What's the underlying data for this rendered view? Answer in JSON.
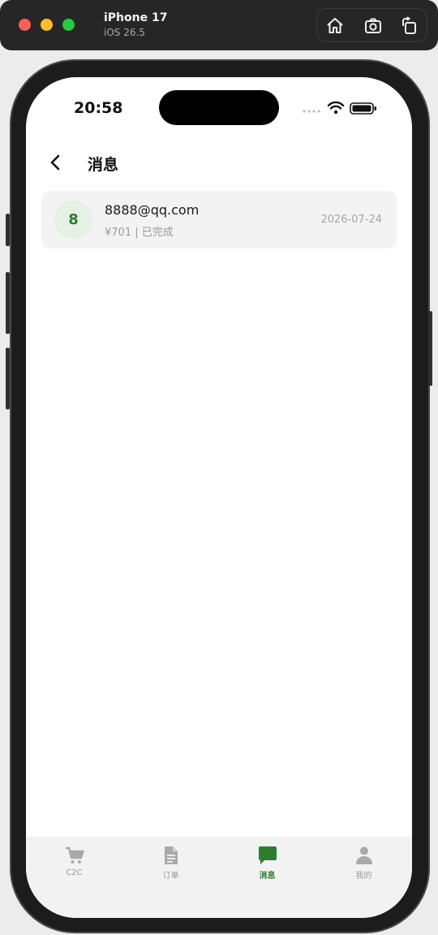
{
  "simulator": {
    "device_name": "iPhone 17",
    "os_version": "iOS 26.5",
    "tools": [
      "home-icon",
      "screenshot-icon",
      "rotate-icon"
    ]
  },
  "status_bar": {
    "time": "20:58"
  },
  "nav": {
    "title": "消息"
  },
  "messages": [
    {
      "avatar_letter": "8",
      "name": "8888@qq.com",
      "subtitle": "¥701 | 已完成",
      "date": "2026-07-24"
    }
  ],
  "tabbar": {
    "tabs": [
      {
        "label": "C2C",
        "icon": "cart-icon",
        "active": false
      },
      {
        "label": "订单",
        "icon": "document-icon",
        "active": false
      },
      {
        "label": "消息",
        "icon": "chat-icon",
        "active": true
      },
      {
        "label": "我的",
        "icon": "person-icon",
        "active": false
      }
    ]
  },
  "colors": {
    "accent": "#2e7d32",
    "avatar_bg": "#e4f1e4",
    "inactive": "#9a9a9a"
  }
}
